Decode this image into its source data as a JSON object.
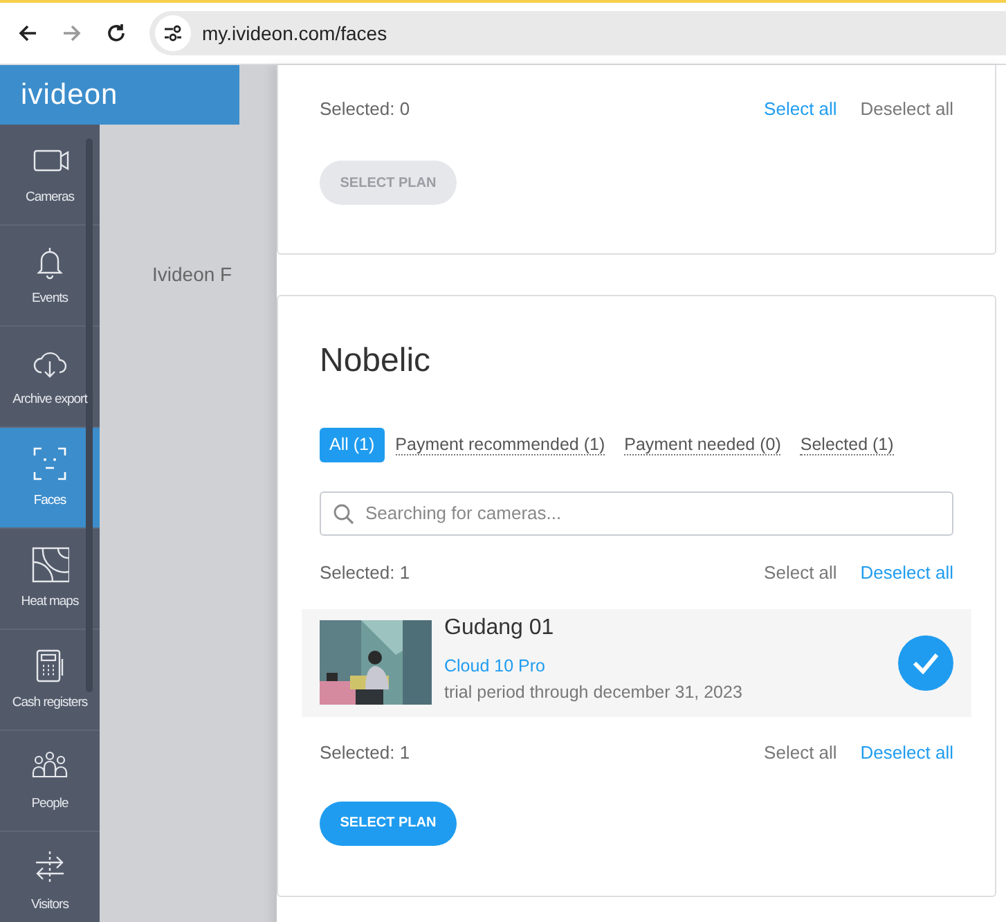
{
  "browser": {
    "url": "my.ivideon.com/faces",
    "forward_disabled": true
  },
  "app": {
    "logo": "ivideon"
  },
  "sidebar": {
    "items": [
      {
        "label": "Cameras",
        "selected": false
      },
      {
        "label": "Events",
        "selected": false
      },
      {
        "label": "Archive export",
        "selected": false
      },
      {
        "label": "Faces",
        "selected": true
      },
      {
        "label": "Heat maps",
        "selected": false
      },
      {
        "label": "Cash registers",
        "selected": false
      },
      {
        "label": "People",
        "selected": false
      },
      {
        "label": "Visitors",
        "selected": false
      }
    ]
  },
  "background_text": "Ivideon F",
  "cards": [
    {
      "selected_count": "Selected: 0",
      "select_all": {
        "label": "Select all",
        "enabled": true
      },
      "deselect_all": {
        "label": "Deselect all",
        "enabled": false
      },
      "button": {
        "label": "SELECT PLAN",
        "disabled": true
      }
    },
    {
      "title": "Nobelic",
      "tabs": [
        {
          "label": "All (1)",
          "selected": true
        },
        {
          "label": "Payment recommended (1)",
          "selected": false
        },
        {
          "label": "Payment needed (0)",
          "selected": false
        },
        {
          "label": "Selected (1)",
          "selected": false
        }
      ],
      "search": {
        "placeholder": "Searching for cameras..."
      },
      "selected_count": "Selected: 1",
      "select_all": {
        "label": "Select all",
        "enabled": false
      },
      "deselect_all": {
        "label": "Deselect all",
        "enabled": true
      },
      "cameras": [
        {
          "name": "Gudang 01",
          "plan": "Cloud 10 Pro",
          "note": "trial period through december 31, 2023",
          "checked": true
        }
      ],
      "footer_count": "Selected: 1",
      "footer_select_all": {
        "label": "Select all",
        "enabled": false
      },
      "footer_deselect_all": {
        "label": "Deselect all",
        "enabled": true
      },
      "button": {
        "label": "SELECT PLAN",
        "disabled": false
      }
    }
  ]
}
